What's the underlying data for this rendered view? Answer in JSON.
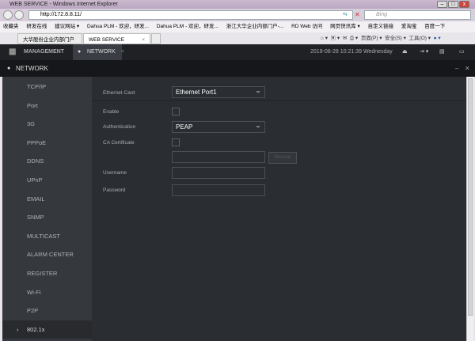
{
  "browser": {
    "title": "WEB SERVICE - Windows Internet Explorer",
    "url": "http://172.8.8.11/",
    "search_placeholder": "Bing",
    "favorites": [
      "收藏夹",
      "研发在线",
      "建议网站 ▾",
      "Dahua PLM - 欢迎，研发...",
      "Dahua PLM - 欢迎，研发...",
      "浙江大华企业内部门户-...",
      "RD Web 访问",
      "网页快讯库 ▾",
      "自定义链接",
      "爱淘宝",
      "百度一下"
    ],
    "tabs": [
      "大华股份企业内部门户",
      "WEB SERVICE"
    ],
    "commands": [
      "页面(P) ▾",
      "安全(S) ▾",
      "工具(O) ▾"
    ]
  },
  "app": {
    "management": "MANAGEMENT",
    "network_tab": "NETWORK",
    "datetime": "2019-08-28 10:21:39 Wednesday",
    "panel_title": "NETWORK"
  },
  "sidebar": [
    "TCP/IP",
    "Port",
    "3G",
    "PPPoE",
    "DDNS",
    "UPnP",
    "EMAIL",
    "SNMP",
    "MULTICAST",
    "ALARM CENTER",
    "REGISTER",
    "Wi-Fi",
    "P2P",
    "802.1x"
  ],
  "form": {
    "ethernet_card_label": "Ethernet Card",
    "ethernet_card_value": "Ethernet Port1",
    "enable_label": "Enable",
    "auth_label": "Authentication",
    "auth_value": "PEAP",
    "ca_label": "CA Certificate",
    "browse": "Browse",
    "username_label": "Username",
    "password_label": "Password"
  }
}
